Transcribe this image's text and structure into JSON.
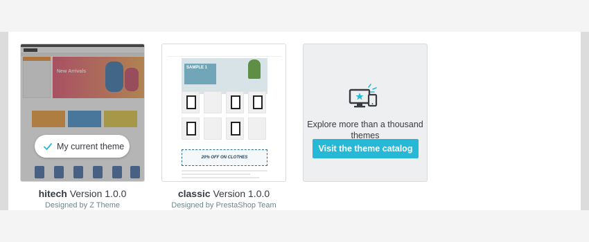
{
  "themes": [
    {
      "name": "hitech",
      "version_text": "Version 1.0.0",
      "author": "Designed by Z Theme",
      "status_label": "My current theme",
      "preview": {
        "banner_text": "New Arrivals"
      }
    },
    {
      "name": "classic",
      "version_text": "Version 1.0.0",
      "author": "Designed by PrestaShop Team",
      "preview": {
        "hero_text": "SAMPLE 1",
        "promo_text": "20% OFF ON CLOTHES"
      }
    }
  ],
  "explore": {
    "text": "Explore more than a thousand themes",
    "button_label": "Visit the theme catalog",
    "icon": "screen-star-icon"
  },
  "colors": {
    "accent": "#25b9d7",
    "background": "#f4f4f4"
  }
}
